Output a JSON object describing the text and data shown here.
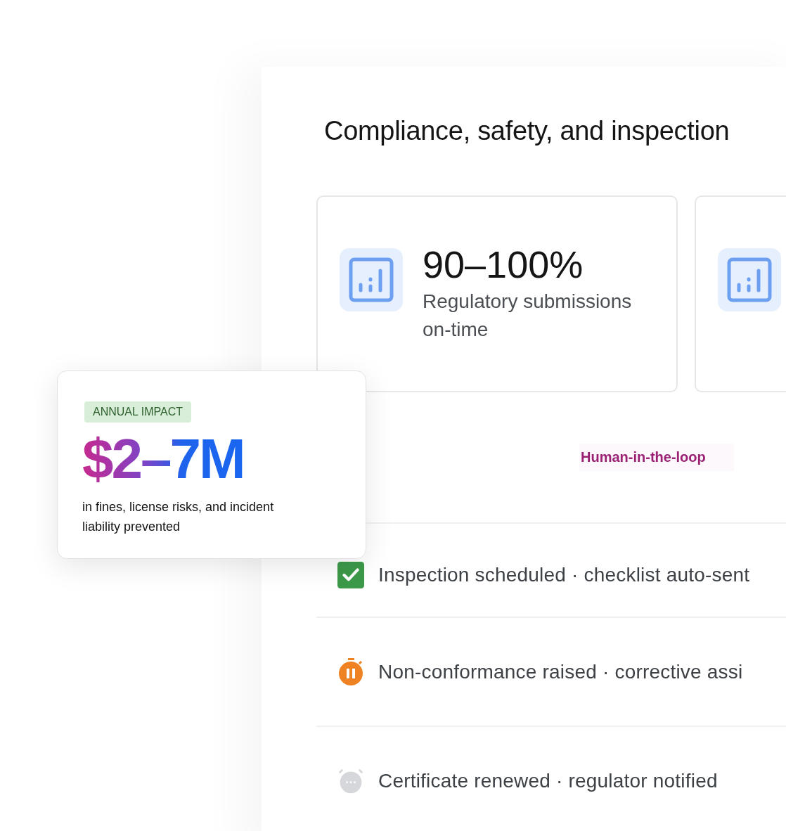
{
  "title": "Compliance, safety, and inspection",
  "stats": [
    {
      "kind": "metric",
      "value": "90–100%",
      "label": "Regulatory submissions on-time"
    },
    {
      "kind": "metric"
    }
  ],
  "impact_card": {
    "badge": "ANNUAL IMPACT",
    "value": "$2–7M",
    "description": "in fines, license risks, and incident liability prevented"
  },
  "tag": "Human-in-the-loop",
  "events": [
    {
      "kind": "done",
      "text": "Inspection scheduled · checklist auto-sent"
    },
    {
      "kind": "paused",
      "text": "Non-conformance raised · corrective assi"
    },
    {
      "kind": "pending",
      "text": "Certificate renewed · regulator notified"
    }
  ]
}
